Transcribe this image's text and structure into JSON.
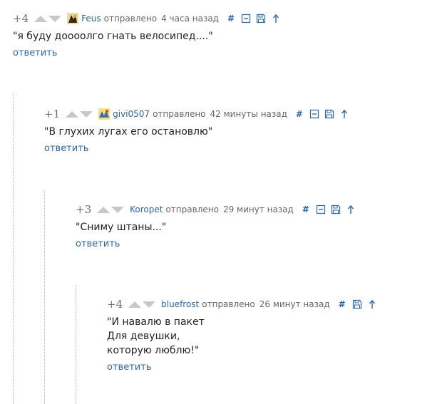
{
  "comments": [
    {
      "score": "+4",
      "author": "Feus",
      "sent": "отправлено",
      "time": "4 часа назад",
      "text": "\"я буду доооолго гнать велосипед....\"",
      "reply": "ответить",
      "icons": [
        "hash-link-icon",
        "collapse-icon",
        "save-icon",
        "parent-arrow-icon"
      ]
    },
    {
      "score": "+1",
      "author": "givi0507",
      "sent": "отправлено",
      "time": "42 минуты назад",
      "text": "\"В глухих лугах его остановлю\"",
      "reply": "ответить",
      "icons": [
        "hash-link-icon",
        "collapse-icon",
        "save-icon",
        "parent-arrow-icon"
      ]
    },
    {
      "score": "+3",
      "author": "Koropet",
      "sent": "отправлено",
      "time": "29 минут назад",
      "text": "\"Сниму штаны...\"",
      "reply": "ответить",
      "icons": [
        "hash-link-icon",
        "collapse-icon",
        "save-icon",
        "parent-arrow-icon"
      ]
    },
    {
      "score": "+4",
      "author": "bluefrost",
      "sent": "отправлено",
      "time": "26 минут назад",
      "text": "\"И навалю в пакет\nДля девушки,\nкоторую люблю!\"",
      "reply": "ответить",
      "icons": [
        "hash-link-icon",
        "save-icon",
        "parent-arrow-icon"
      ]
    }
  ],
  "colors": {
    "link": "#2a66b5",
    "vote_arrow": "#c8c8c8",
    "score": "#6f6f6f",
    "thread_line": "#b8b8b8"
  }
}
